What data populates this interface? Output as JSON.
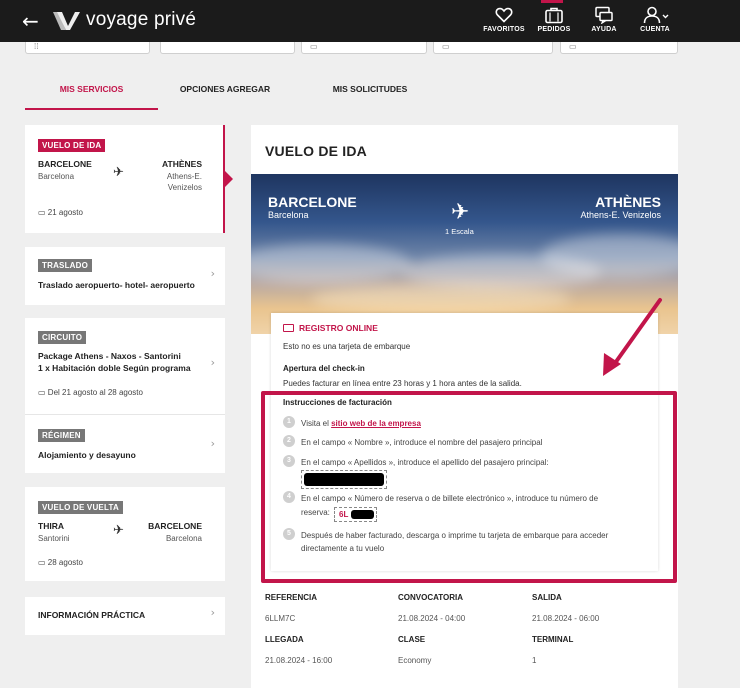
{
  "brand": {
    "name": "voyage privé",
    "accent": "#c2154a"
  },
  "topnav": {
    "back": "←",
    "items": [
      {
        "label": "FAVORITOS",
        "icon": "heart-icon"
      },
      {
        "label": "PEDIDOS",
        "icon": "briefcase-icon"
      },
      {
        "label": "AYUDA",
        "icon": "help-chat-icon"
      },
      {
        "label": "CUENTA",
        "icon": "user-icon"
      }
    ]
  },
  "tabs": [
    "MIS SERVICIOS",
    "OPCIONES AGREGAR",
    "MIS SOLICITUDES"
  ],
  "sidebar": {
    "outbound": {
      "badge": "VUELO DE IDA",
      "from": "BARCELONE",
      "from_sub": "Barcelona",
      "to": "ATHÈNES",
      "to_sub_1": "Athens-E.",
      "to_sub_2": "Venizelos",
      "date": "21 agosto"
    },
    "transfer": {
      "badge": "TRASLADO",
      "title": "Traslado aeropuerto- hotel- aeropuerto"
    },
    "circuit": {
      "badge": "CIRCUITO",
      "title_1": "Package Athens - Naxos - Santorini",
      "title_2": "1 x Habitación doble Según programa",
      "date": "Del 21 agosto al 28 agosto"
    },
    "regime": {
      "badge": "RÉGIMEN",
      "title": "Alojamiento y desayuno"
    },
    "inbound": {
      "badge": "VUELO DE VUELTA",
      "from": "THIRA",
      "from_sub": "Santorini",
      "to": "BARCELONE",
      "to_sub": "Barcelona",
      "date": "28 agosto"
    },
    "info": {
      "title": "INFORMACIÓN PRÁCTICA"
    }
  },
  "main": {
    "title": "VUELO DE IDA",
    "hero": {
      "from": "BARCELONE",
      "from_sub": "Barcelona",
      "to": "ATHÈNES",
      "to_sub": "Athens-E. Venizelos",
      "stops": "1 Escala"
    },
    "checkin": {
      "header": "REGISTRO ONLINE",
      "note": "Esto no es una tarjeta de embarque",
      "opening_title": "Apertura del check-in",
      "opening_text": "Puedes facturar en línea entre 23 horas y 1 hora antes de la salida.",
      "instructions_title": "Instrucciones de facturación",
      "steps": [
        {
          "num": "1",
          "pre": "Visita el ",
          "link": "sitio web de la empresa"
        },
        {
          "num": "2",
          "text": "En el campo « Nombre », introduce el nombre del pasajero principal"
        },
        {
          "num": "3",
          "text": "En el campo « Apellidos », introduce el apellido del pasajero principal:"
        },
        {
          "num": "4",
          "text_1": "En el campo « Número de reserva o de billete electrónico », introduce tu número de",
          "text_2": "reserva:",
          "code_prefix": "6L"
        },
        {
          "num": "5",
          "text_1": "Después de haber facturado, descarga o imprime tu tarjeta de embarque para acceder",
          "text_2": "directamente a tu vuelo"
        }
      ]
    },
    "details": [
      {
        "label": "REFERENCIA",
        "value": "6LLM7C"
      },
      {
        "label": "CONVOCATORIA",
        "value": "21.08.2024 - 04:00"
      },
      {
        "label": "SALIDA",
        "value": "21.08.2024 - 06:00"
      },
      {
        "label": "LLEGADA",
        "value": "21.08.2024 - 16:00"
      },
      {
        "label": "CLASE",
        "value": "Economy"
      },
      {
        "label": "TERMINAL",
        "value": "1"
      }
    ]
  }
}
